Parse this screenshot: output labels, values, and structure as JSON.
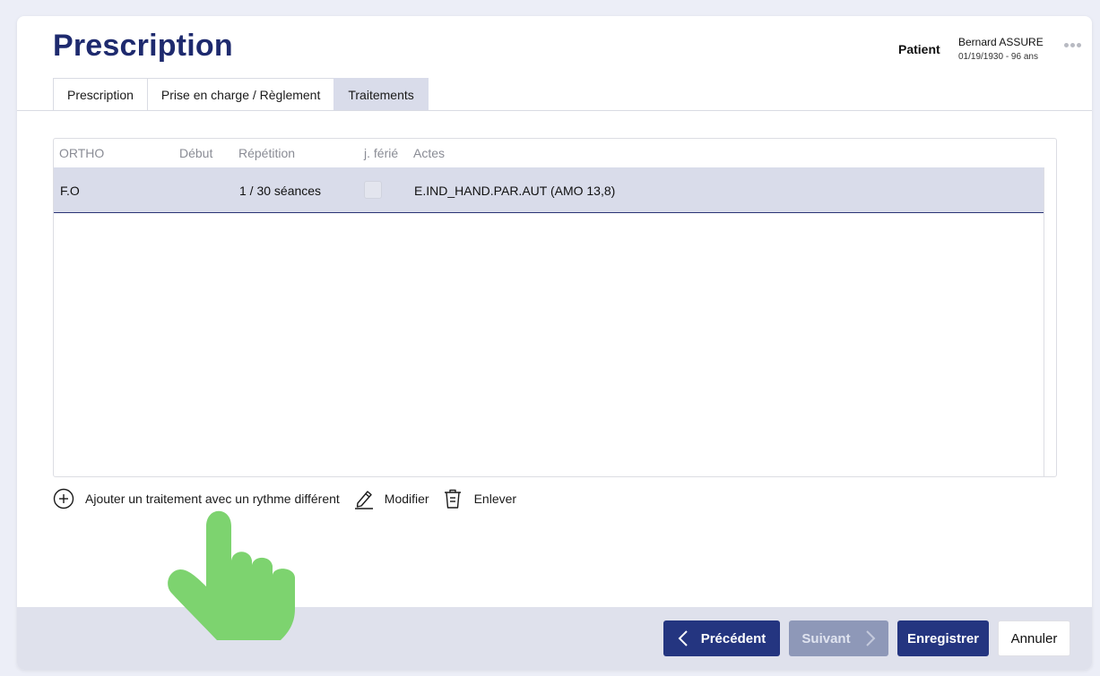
{
  "header": {
    "title": "Prescription",
    "patient_label": "Patient",
    "patient_name": "Bernard ASSURE",
    "patient_dob": "01/19/1930 - 96 ans"
  },
  "tabs": [
    {
      "label": "Prescription"
    },
    {
      "label": "Prise en charge / Règlement"
    },
    {
      "label": "Traitements",
      "active": true
    }
  ],
  "table": {
    "columns": [
      "ORTHO",
      "Début",
      "Répétition",
      "j. férié",
      "Actes"
    ],
    "rows": [
      {
        "ortho": "F.O",
        "debut": "",
        "repetition": "1 / 30 séances",
        "ferie": false,
        "actes": "E.IND_HAND.PAR.AUT (AMO 13,8)"
      }
    ]
  },
  "actions": {
    "add": "Ajouter un traitement avec un rythme différent",
    "edit": "Modifier",
    "remove": "Enlever"
  },
  "footer": {
    "prev": "Précédent",
    "next": "Suivant",
    "save": "Enregistrer",
    "cancel": "Annuler"
  },
  "colors": {
    "primary": "#243580",
    "title": "#1e2a6e",
    "selected_row": "#d9dcea",
    "disabled_button": "#8e98b8",
    "pointer_hand": "#7dd36f"
  },
  "icons": [
    "more-icon",
    "plus-circle-icon",
    "pencil-icon",
    "trash-icon",
    "chevron-left-icon",
    "chevron-right-icon",
    "pointing-hand-icon"
  ]
}
